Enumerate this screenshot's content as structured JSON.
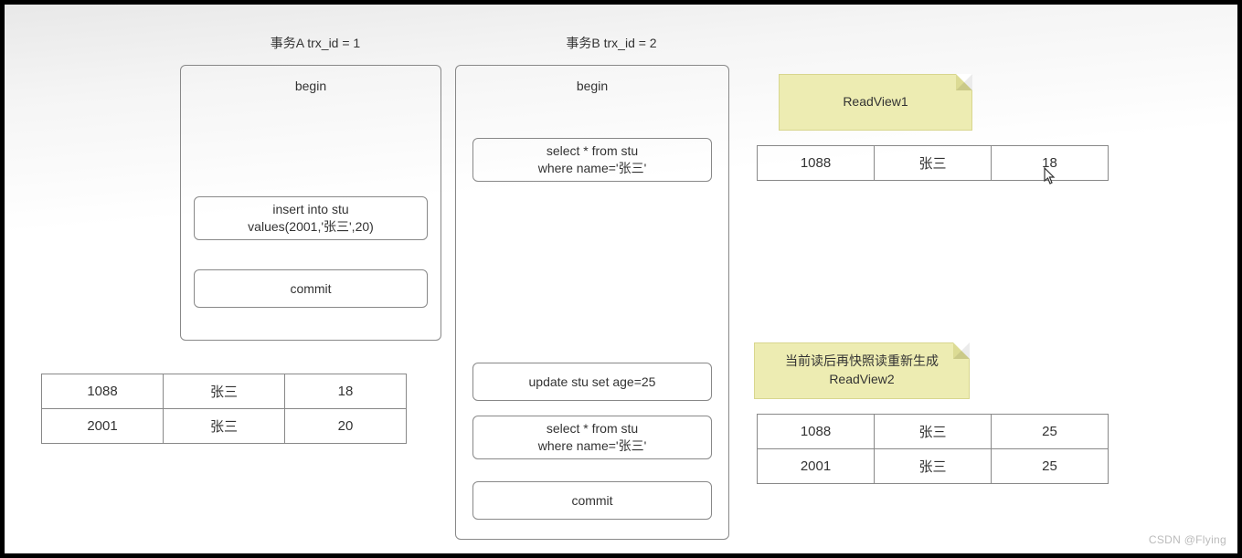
{
  "txA": {
    "title": "事务A trx_id = 1",
    "begin": "begin",
    "steps": [
      "insert into stu\nvalues(2001,'张三',20)",
      "commit"
    ]
  },
  "txB": {
    "title": "事务B trx_id = 2",
    "begin": "begin",
    "steps": [
      "select * from stu\nwhere name='张三'",
      "update stu set age=25",
      "select * from stu\nwhere name='张三'",
      "commit"
    ]
  },
  "notes": {
    "readview1": "ReadView1",
    "readview2": "当前读后再快照读重新生成\nReadView2"
  },
  "tables": {
    "left": {
      "rows": [
        [
          "1088",
          "张三",
          "18"
        ],
        [
          "2001",
          "张三",
          "20"
        ]
      ]
    },
    "rv1": {
      "rows": [
        [
          "1088",
          "张三",
          "18"
        ]
      ]
    },
    "rv2": {
      "rows": [
        [
          "1088",
          "张三",
          "25"
        ],
        [
          "2001",
          "张三",
          "25"
        ]
      ]
    }
  },
  "watermark": "CSDN @Flying",
  "chart_data": {
    "type": "table",
    "description": "MVCC ReadView diagram showing two transactions A(trx_id=1) and B(trx_id=2) with resulting snapshot tables",
    "transaction_A": {
      "trx_id": 1,
      "ops": [
        "begin",
        "insert into stu values(2001,'张三',20)",
        "commit"
      ]
    },
    "transaction_B": {
      "trx_id": 2,
      "ops": [
        "begin",
        "select * from stu where name='张三'",
        "update stu set age=25",
        "select * from stu where name='张三'",
        "commit"
      ]
    },
    "storage_after_txA": [
      {
        "id": 1088,
        "name": "张三",
        "age": 18
      },
      {
        "id": 2001,
        "name": "张三",
        "age": 20
      }
    ],
    "ReadView1_result": [
      {
        "id": 1088,
        "name": "张三",
        "age": 18
      }
    ],
    "ReadView2_result": [
      {
        "id": 1088,
        "name": "张三",
        "age": 25
      },
      {
        "id": 2001,
        "name": "张三",
        "age": 25
      }
    ]
  }
}
